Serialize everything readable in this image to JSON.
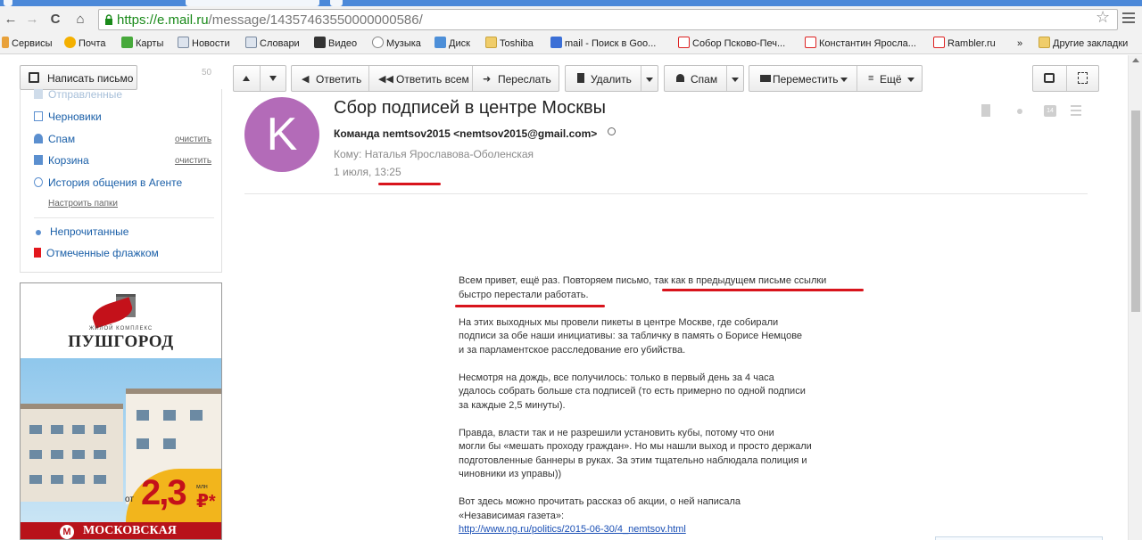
{
  "browser": {
    "url_host": "https://e.mail.ru",
    "url_path": "/message/14357463550000000586/",
    "bookmarks": [
      "Сервисы",
      "Почта",
      "Карты",
      "Новости",
      "Словари",
      "Видео",
      "Музыка",
      "Диск",
      "Toshiba",
      "mail - Поиск в Goo...",
      "Собор Псково-Печ...",
      "Константин Яросла...",
      "Rambler.ru",
      "Другие закладки"
    ],
    "bookmarks_more": "»"
  },
  "sidebar": {
    "compose_label": "Написать письмо",
    "unread_count": "50",
    "folders": [
      {
        "label": "Отправленные",
        "faded": true
      },
      {
        "label": "Черновики"
      },
      {
        "label": "Спам",
        "clear": "очистить"
      },
      {
        "label": "Корзина",
        "clear": "очистить"
      },
      {
        "label": "История общения в Агенте"
      }
    ],
    "setup_label": "Настроить папки",
    "filters": [
      "Непрочитанные",
      "Отмеченные флажком"
    ]
  },
  "ad": {
    "tagline": "ЖИЛОЙ КОМПЛЕКС",
    "brand": "ПУШГОРОД",
    "price_prefix": "от",
    "price": "2,3",
    "price_unit": "млн",
    "currency": "₽*",
    "metro_letter": "М",
    "location": "МОСКОВСКАЯ"
  },
  "toolbar": {
    "reply": "Ответить",
    "reply_all": "Ответить всем",
    "forward": "Переслать",
    "delete": "Удалить",
    "spam": "Спам",
    "move": "Переместить",
    "more": "Ещё"
  },
  "message": {
    "avatar_letter": "K",
    "subject": "Сбор подписей в центре Москвы",
    "from": "Команда nemtsov2015 <nemtsov2015@gmail.com>",
    "to_label": "Кому:",
    "to": "Наталья Ярославова-Оболенская",
    "date_prefix": "1 июля,",
    "time": "13:25",
    "calendar_day": "14",
    "paragraphs": [
      [
        "Всем привет, ещё раз. Повторяем письмо, так как в предыдущем письме ссылки",
        "быстро перестали работать."
      ],
      [
        "На этих выходных мы провели пикеты в центре Москве, где собирали",
        "подписи за обе наши инициативы: за табличку в память о Борисе Немцове",
        "и за парламентское расследование его убийства."
      ],
      [
        "Несмотря на дождь, все получилось: только в первый день за 4 часа",
        "удалось собрать больше ста подписей (то есть примерно по одной подписи",
        "за каждые 2,5 минуты)."
      ],
      [
        "Правда, власти так и не разрешили установить кубы, потому что они",
        "могли бы «мешать проходу граждан». Но мы нашли выход и просто держали",
        "подготовленные баннеры в руках. За этим тщательно наблюдала полиция и",
        "чиновники из управы))"
      ],
      [
        "Вот здесь можно прочитать рассказ об акции, о ней написала",
        "«Независимая газета»:"
      ]
    ],
    "link": "http://www.ng.ru/politics/2015-06-30/4_nemtsov.html"
  },
  "colors": {
    "accent_red": "#d8141c",
    "link_blue": "#1a5fa8",
    "avatar": "#b36bb8",
    "url_green": "#1a8a1a"
  }
}
